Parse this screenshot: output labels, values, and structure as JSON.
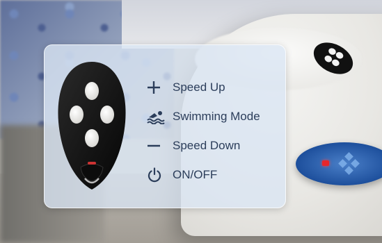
{
  "legend": {
    "items": [
      {
        "icon": "plus-icon",
        "label": "Speed Up"
      },
      {
        "icon": "swimmer-icon",
        "label": "Swimming Mode"
      },
      {
        "icon": "minus-icon",
        "label": "Speed Down"
      },
      {
        "icon": "power-icon",
        "label": "ON/OFF"
      }
    ]
  },
  "colors": {
    "text": "#2b3d5a",
    "remote_body": "#141414",
    "remote_buttons": "#ecebe8",
    "panel_blue": "#1d4f9c",
    "led_red": "#e6262b"
  }
}
